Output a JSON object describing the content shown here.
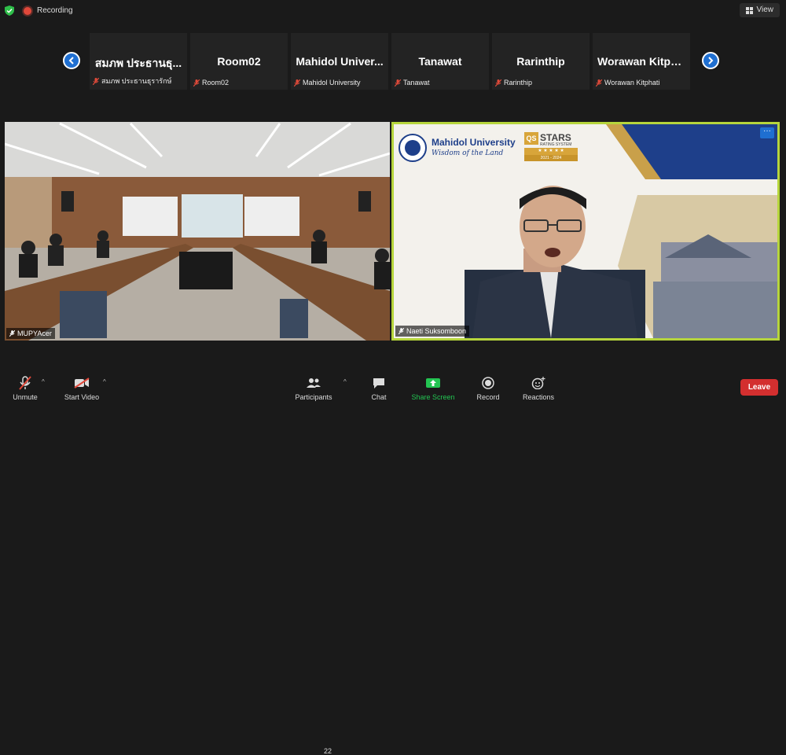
{
  "topbar": {
    "recording_label": "Recording",
    "view_label": "View"
  },
  "gallery": {
    "tiles": [
      {
        "name": "สมภพ  ประธานธุ...",
        "footer": "สมภพ  ประธานธุรารักษ์"
      },
      {
        "name": "Room02",
        "footer": "Room02"
      },
      {
        "name": "Mahidol Univer...",
        "footer": "Mahidol University"
      },
      {
        "name": "Tanawat",
        "footer": "Tanawat"
      },
      {
        "name": "Rarinthip",
        "footer": "Rarinthip"
      },
      {
        "name": "Worawan  Kitph...",
        "footer": "Worawan Kitphati"
      }
    ]
  },
  "videos": {
    "left_label": "MUPYAcer",
    "right_label": "Naeti Suksomboon",
    "slide": {
      "university": "Mahidol University",
      "motto": "Wisdom of the Land",
      "qs_badge": "QS",
      "stars_title": "STARS",
      "stars_sub": "RATING SYSTEM",
      "stars_stars": "★ ★ ★ ★ ★",
      "stars_years": "2021 - 2024"
    }
  },
  "toolbar": {
    "unmute": "Unmute",
    "start_video": "Start Video",
    "participants": "Participants",
    "participants_count": "22",
    "chat": "Chat",
    "share_screen": "Share Screen",
    "record": "Record",
    "reactions": "Reactions",
    "leave": "Leave"
  },
  "colors": {
    "accent": "#1f6fd1",
    "active_speaker_border": "#b6d53c",
    "leave": "#d32f2f",
    "share_green": "#23c552"
  }
}
